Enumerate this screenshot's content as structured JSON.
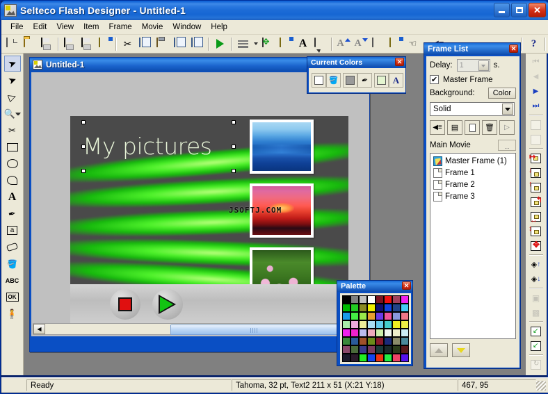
{
  "window": {
    "title": "Selteco Flash Designer - Untitled-1",
    "icon": "app-icon",
    "minimize_label": "_",
    "maximize_label": "□",
    "close_label": "✕"
  },
  "menubar": {
    "items": [
      {
        "label": "File"
      },
      {
        "label": "Edit"
      },
      {
        "label": "View"
      },
      {
        "label": "Item"
      },
      {
        "label": "Frame"
      },
      {
        "label": "Movie"
      },
      {
        "label": "Window"
      },
      {
        "label": "Help"
      }
    ]
  },
  "toolbar": {
    "items": [
      {
        "name": "new-icon",
        "glyph": ""
      },
      {
        "name": "open-icon",
        "glyph": ""
      },
      {
        "name": "save-icon",
        "glyph": ""
      },
      {
        "name": "save-as-icon",
        "glyph": ""
      },
      {
        "name": "export-icon",
        "glyph": ""
      },
      {
        "name": "import-image-icon",
        "glyph": ""
      },
      {
        "name": "cut-icon",
        "glyph": "✂"
      },
      {
        "name": "copy-icon",
        "glyph": ""
      },
      {
        "name": "paste-icon",
        "glyph": ""
      },
      {
        "name": "insert-frame-icon",
        "glyph": ""
      },
      {
        "name": "duplicate-frame-icon",
        "glyph": ""
      },
      {
        "name": "preview-play-icon",
        "glyph": ""
      },
      {
        "name": "align-icon",
        "glyph": ""
      },
      {
        "name": "align-dropdown-icon",
        "glyph": ""
      },
      {
        "name": "transform-icon",
        "glyph": ""
      },
      {
        "name": "fill-icon",
        "glyph": ""
      },
      {
        "name": "text-icon",
        "glyph": "A"
      },
      {
        "name": "balloon-icon",
        "glyph": ""
      },
      {
        "name": "font-increase-icon",
        "glyph": "A"
      },
      {
        "name": "font-decrease-icon",
        "glyph": "A"
      },
      {
        "name": "gradient-icon",
        "glyph": ""
      },
      {
        "name": "texture-icon",
        "glyph": ""
      },
      {
        "name": "hand-icon",
        "glyph": "☜"
      },
      {
        "name": "hand-dropdown-icon",
        "glyph": ""
      },
      {
        "name": "sound-icon",
        "glyph": "◀"
      },
      {
        "name": "sound-dropdown-icon",
        "glyph": ""
      },
      {
        "name": "help-icon",
        "glyph": "?"
      }
    ]
  },
  "left_toolbox": {
    "tools": [
      {
        "name": "select-tool",
        "glyph": "➤",
        "selected": true
      },
      {
        "name": "subselect-tool",
        "glyph": "➤",
        "selected": false
      },
      {
        "name": "node-edit-tool",
        "glyph": "▷",
        "selected": false
      },
      {
        "name": "zoom-tool",
        "glyph": "🔍",
        "selected": false
      },
      {
        "name": "scissors-tool",
        "glyph": "✂",
        "selected": false
      },
      {
        "name": "rectangle-tool",
        "glyph": "▭",
        "selected": false
      },
      {
        "name": "ellipse-tool",
        "glyph": "◯",
        "selected": false
      },
      {
        "name": "freeform-tool",
        "glyph": "⬭",
        "selected": false
      },
      {
        "name": "text-tool",
        "glyph": "A",
        "selected": false
      },
      {
        "name": "eyedropper-tool",
        "glyph": "✒",
        "selected": false
      },
      {
        "name": "edit-field-tool",
        "glyph": "a",
        "selected": false
      },
      {
        "name": "eraser-tool",
        "glyph": "▱",
        "selected": false
      },
      {
        "name": "paint-bucket-tool",
        "glyph": "🪣",
        "selected": false
      },
      {
        "name": "abc-tool",
        "glyph": "ABC",
        "selected": false
      },
      {
        "name": "ok-button-tool",
        "glyph": "OK",
        "selected": false
      },
      {
        "name": "character-tool",
        "glyph": "🧍",
        "selected": false
      }
    ]
  },
  "right_toolbar": {
    "tools": [
      {
        "name": "first-frame-icon",
        "glyph": "⏮"
      },
      {
        "name": "previous-frame-icon",
        "glyph": "◀"
      },
      {
        "name": "next-frame-icon",
        "glyph": "▶"
      },
      {
        "name": "last-frame-icon",
        "glyph": "⏭"
      },
      {
        "name": "copy-to-frame-icon",
        "glyph": ""
      },
      {
        "name": "move-to-frame-icon",
        "glyph": ""
      },
      {
        "name": "align-left-icon",
        "glyph": ""
      },
      {
        "name": "align-bottom-icon",
        "glyph": ""
      },
      {
        "name": "align-top-icon",
        "glyph": ""
      },
      {
        "name": "align-right-icon",
        "glyph": ""
      },
      {
        "name": "center-horizontal-icon",
        "glyph": ""
      },
      {
        "name": "center-vertical-icon",
        "glyph": ""
      },
      {
        "name": "center-both-icon",
        "glyph": ""
      },
      {
        "name": "bring-forward-icon",
        "glyph": ""
      },
      {
        "name": "send-backward-icon",
        "glyph": ""
      },
      {
        "name": "group-icon",
        "glyph": ""
      },
      {
        "name": "ungroup-icon",
        "glyph": ""
      },
      {
        "name": "snap-icon",
        "glyph": ""
      },
      {
        "name": "snap-grid-icon",
        "glyph": ""
      },
      {
        "name": "rotate-icon",
        "glyph": "↻"
      }
    ]
  },
  "document_window": {
    "title": "Untitled-1",
    "icon": "document-icon",
    "canvas": {
      "heading": "My pictures",
      "photos": [
        {
          "name": "photo-mountains",
          "alt": "blue mountain landscape"
        },
        {
          "name": "photo-sunset",
          "alt": "pink red sunset over water",
          "watermark": "JSOFTJ.COM"
        },
        {
          "name": "photo-waterlilies",
          "alt": "pink water lilies on lily pads"
        }
      ],
      "buttons": [
        {
          "name": "stop-button",
          "shape": "square",
          "color": "#e01010"
        },
        {
          "name": "play-button",
          "shape": "triangle",
          "color": "#12c412"
        }
      ]
    }
  },
  "current_colors": {
    "title": "Current Colors",
    "close_label": "✕",
    "swatches": [
      {
        "name": "fill-color-swatch",
        "color": "#ffffff",
        "icon": "paint-bucket-icon"
      },
      {
        "name": "line-color-swatch",
        "color": "#9a9a9a",
        "icon": "pen-icon"
      },
      {
        "name": "text-color-swatch",
        "color": "#e4f5d0",
        "icon": "text-A-icon",
        "letter": "A"
      }
    ]
  },
  "palette": {
    "title": "Palette",
    "close_label": "✕",
    "colors": [
      "#000000",
      "#808080",
      "#c0c0c0",
      "#ffffff",
      "#7a1320",
      "#ee1111",
      "#a0405c",
      "#ee22ee",
      "#00bb00",
      "#22cc22",
      "#8a8a22",
      "#eeee00",
      "#101070",
      "#1144dd",
      "#224488",
      "#44ccf4",
      "#1a9ae8",
      "#44ee44",
      "#9ae84a",
      "#e8a030",
      "#6a3ae8",
      "#ee5599",
      "#8899dd",
      "#ee7788",
      "#aaeeaa",
      "#eeaadd",
      "#eeee99",
      "#aadff4",
      "#66ccee",
      "#44cccc",
      "#eeee22",
      "#eeee44",
      "#ee22ee",
      "#ee22cc",
      "#bbbbee",
      "#eeaabb",
      "#cceeaa",
      "#eef4ee",
      "#eeeecc",
      "#cceef4",
      "#3a8a3a",
      "#2a5a9a",
      "#a0502a",
      "#6a8a1a",
      "#8a1a2a",
      "#1a2a7a",
      "#8a8a6a",
      "#4a8a9a",
      "#8a4a6a",
      "#4a6a3a",
      "#3a3a8a",
      "#7a3a5a",
      "#1a3a3a",
      "#1a2a2a",
      "#2a3a1a",
      "#5a1a1a",
      "#1a1a2a",
      "#2a1a2a",
      "#22ee22",
      "#1144ee",
      "#ee3311",
      "#22ee44",
      "#ee4466",
      "#5511ee"
    ]
  },
  "frame_list": {
    "title": "Frame List",
    "close_label": "✕",
    "delay_label": "Delay:",
    "delay_value": "1",
    "delay_unit": "s.",
    "master_frame_label": "Master Frame",
    "master_frame_checked": "✔",
    "background_label": "Background:",
    "color_button_label": "Color",
    "fill_type": "Solid",
    "fill_options": [
      "Solid"
    ],
    "tool_buttons": [
      {
        "name": "frame-sound-button",
        "glyph": "◀"
      },
      {
        "name": "frame-properties-button",
        "glyph": "▤"
      },
      {
        "name": "new-frame-button",
        "glyph": "▯"
      },
      {
        "name": "delete-frame-button",
        "glyph": "🗑"
      },
      {
        "name": "preview-frame-button",
        "glyph": "▷"
      }
    ],
    "main_movie_label": "Main Movie",
    "browse_label": "...",
    "items": [
      {
        "label": "Master Frame (1)",
        "icon": "master-frame-icon"
      },
      {
        "label": "Frame 1",
        "icon": "frame-icon"
      },
      {
        "label": "Frame 2",
        "icon": "frame-icon"
      },
      {
        "label": "Frame 3",
        "icon": "frame-icon"
      }
    ],
    "move_up_label": "▲",
    "move_down_label": "▼"
  },
  "statusbar": {
    "ready": "Ready",
    "object_info": "Tahoma, 32 pt, Text2 211 x 51 (X:21 Y:18)",
    "coordinates": "467, 95"
  }
}
